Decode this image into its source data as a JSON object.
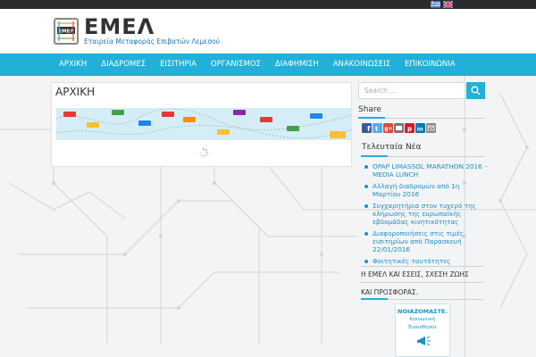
{
  "site": {
    "logo_title": "ΕΜΕΛ",
    "logo_subtitle": "Εταιρεία Μεταφοράς Επιβατών Λεμεσού",
    "logo_badge": "ΕΜΕΛ"
  },
  "topbar": {
    "languages": [
      "greek-flag",
      "uk-flag"
    ]
  },
  "nav": {
    "items": [
      {
        "label": "ΑΡΧΙΚΗ"
      },
      {
        "label": "ΔΙΑΔΡΟΜΕΣ"
      },
      {
        "label": "ΕΙΣΙΤΗΡΙΑ"
      },
      {
        "label": "ΟΡΓΑΝΙΣΜΟΣ"
      },
      {
        "label": "ΔΙΑΦΗΜΙΣΗ"
      },
      {
        "label": "ΑΝΑΚΟΙΝΩΣΕΙΣ"
      },
      {
        "label": "ΕΠΙΚΟΙΝΩΝΙΑ"
      }
    ]
  },
  "main": {
    "page_title": "ΑΡΧΙΚΗ"
  },
  "sidebar": {
    "search_placeholder": "Search ...",
    "share_title": "Share",
    "share_icons": [
      "facebook-icon",
      "twitter-icon",
      "googleplus-icon",
      "digg-icon",
      "pinterest-icon",
      "linkedin-icon",
      "email-icon"
    ],
    "news_title": "Τελευταία Νέα",
    "news": [
      {
        "label": "OPAP LIMASSOL MARATHON 2016 – MEDIA LUNCH"
      },
      {
        "label": "Αλλαγή διαδρομών από 1η Μαρτίου 2016"
      },
      {
        "label": "Συγχαρητήρια στον τυχερό της κλήρωσης της ευρωπαϊκής εβδομάδας κινητικότητας"
      },
      {
        "label": "Διαφοροποιήσεις στις τιμές εισιτηρίων από Παρασκευή 22/01/2016"
      },
      {
        "label": "Φοιτητικές ταυτότητες"
      }
    ],
    "emel_title": "Η ΕΜΕΛ ΚΑΙ ΕΣΕΙΣ, ΣΧΕΣΗ ΖΩΗΣ",
    "emel_title2": "ΚΑΙ ΠΡΟΣΦΟΡΑΣ.",
    "card": {
      "title": "ΝΟΙΑΖΟΜΑΣΤΕ.",
      "sub1": "Κοινωνική",
      "sub2": "Ευαισθησία"
    }
  },
  "colors": {
    "accent": "#20b0d8",
    "topbar": "#2b2b2b",
    "link": "#1a8fc8"
  }
}
